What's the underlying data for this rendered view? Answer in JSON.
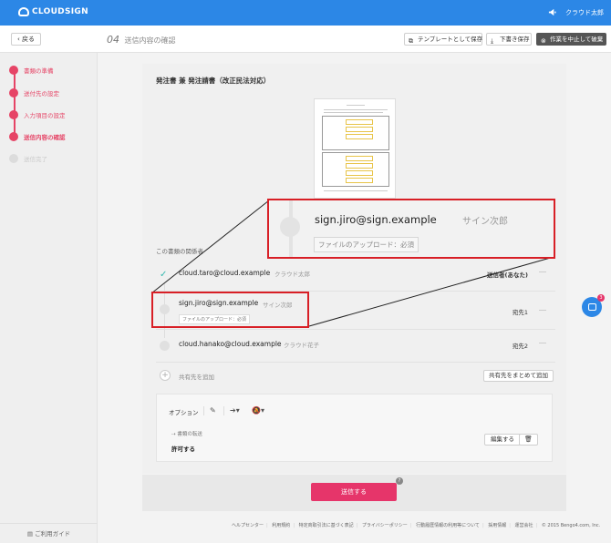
{
  "header": {
    "logo": "CLOUDSIGN",
    "user_name": "クラウド太郎",
    "brand_color": "#2c87e6"
  },
  "subheader": {
    "back_label": "戻る",
    "step_number": "04",
    "step_title": "送信内容の確認",
    "template_label": "テンプレートとして保存",
    "draft_label": "下書き保存",
    "cancel_label": "作業を中止して破棄"
  },
  "sidebar": {
    "steps": [
      {
        "label": "書類の準備",
        "state": "done"
      },
      {
        "label": "送付先の設定",
        "state": "done"
      },
      {
        "label": "入力項目の設定",
        "state": "done"
      },
      {
        "label": "送信内容の確認",
        "state": "current"
      },
      {
        "label": "送信完了",
        "state": "future"
      }
    ],
    "guide_label": "ご利用ガイド",
    "accent_color": "#e64466"
  },
  "document": {
    "title": "発注書 兼 発注請書（改正民法対応）",
    "thumbnail_icon": "document-preview"
  },
  "recipients": {
    "section_label": "この書類の関係者",
    "items": [
      {
        "email": "cloud.taro@cloud.example",
        "name": "クラウド太郎",
        "role": "送信者(あなた)",
        "tag": ""
      },
      {
        "email": "sign.jiro@sign.example",
        "name": "サイン次郎",
        "role": "宛先1",
        "tag": "ファイルのアップロード：必須"
      },
      {
        "email": "cloud.hanako@cloud.example",
        "name": "クラウド花子",
        "role": "宛先2",
        "tag": ""
      }
    ],
    "add_label": "共有先を追加",
    "add_bulk_label": "共有先をまとめて追加"
  },
  "zoom": {
    "email": "sign.jiro@sign.example",
    "name": "サイン次郎",
    "tag": "ファイルのアップロード：必須",
    "highlight_color": "#d81f26"
  },
  "options": {
    "label": "オプション",
    "transfer_label": "書類の転送",
    "transfer_value": "許可する",
    "edit_label": "編集する"
  },
  "send": {
    "label": "送信する",
    "help": "?",
    "color": "#e6356a"
  },
  "footer": {
    "links": [
      "ヘルプセンター",
      "利用規約",
      "特定商取引法に基づく表記",
      "プライバシーポリシー",
      "行動履歴情報の利用等について",
      "採用情報",
      "運営会社"
    ],
    "copyright": "© 2015 Bengo4.com, Inc."
  },
  "chat": {
    "badge": "3"
  }
}
